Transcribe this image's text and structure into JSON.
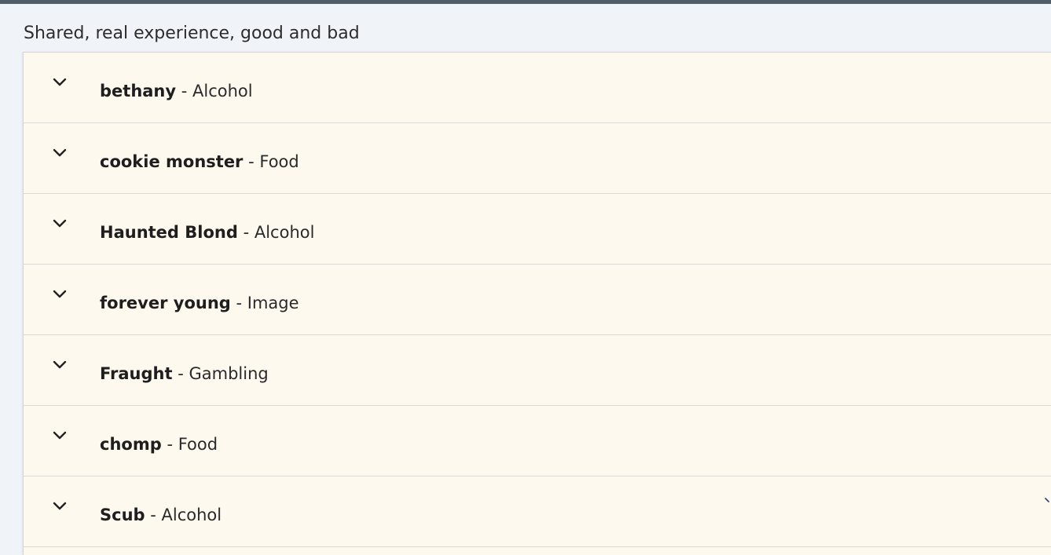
{
  "heading": "Shared, real experience, good and bad",
  "separator": "-",
  "items": [
    {
      "name": "bethany",
      "category": "Alcohol"
    },
    {
      "name": "cookie monster",
      "category": "Food"
    },
    {
      "name": "Haunted Blond",
      "category": "Alcohol"
    },
    {
      "name": "forever young",
      "category": "Image"
    },
    {
      "name": "Fraught",
      "category": "Gambling"
    },
    {
      "name": "chomp",
      "category": "Food"
    },
    {
      "name": "Scub",
      "category": "Alcohol"
    }
  ],
  "icons": {
    "expand": "chevron-down-icon"
  },
  "colors": {
    "background": "#f0f4f9",
    "panel": "#fdf9ee",
    "top_bar": "#4f5f6a",
    "divider": "#d9d9d9"
  }
}
